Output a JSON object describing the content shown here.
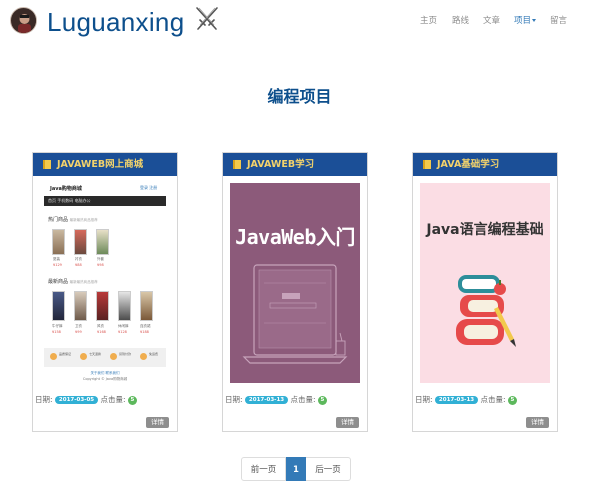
{
  "header": {
    "brand": "Luguanxing",
    "nav": [
      {
        "label": "主页",
        "active": false
      },
      {
        "label": "路线",
        "active": false
      },
      {
        "label": "文章",
        "active": false
      },
      {
        "label": "项目",
        "active": true,
        "dropdown": true
      },
      {
        "label": "留言",
        "active": false
      }
    ]
  },
  "page_title": "编程项目",
  "cards": [
    {
      "title": "JAVAWEB网上商城",
      "date_label": "日期:",
      "date": "2017-03-05",
      "clicks_label": "点击量:",
      "clicks": "5",
      "detail_label": "详情",
      "shop": {
        "logo": "Java购物商城",
        "links": "登录 注册",
        "nav_text": "首页  手机数码  电脑办公",
        "section1": "热门商品",
        "section1_sub": "最新最热商品推荐",
        "section2": "最新商品",
        "section2_sub": "最新最热商品推荐",
        "row1_labels": [
          "夏装",
          "衬衣",
          "外套"
        ],
        "row1_prices": [
          "¥129",
          "¥88",
          "¥98"
        ],
        "row2_labels": [
          "牛仔裤",
          "卫衣",
          "风衣",
          "休闲裤",
          "连衣裙"
        ],
        "row2_prices": [
          "¥158",
          "¥99",
          "¥168",
          "¥128",
          "¥188"
        ],
        "features": [
          "品质保证",
          "七天退换",
          "货到付款",
          "免运费"
        ],
        "footer1": "关于我们  联系我们",
        "footer2": "Copyright © Java购物商城"
      }
    },
    {
      "title": "JAVAWEB学习",
      "date_label": "日期:",
      "date": "2017-03-13",
      "clicks_label": "点击量:",
      "clicks": "5",
      "detail_label": "详情",
      "cover_title": "JavaWeb入门"
    },
    {
      "title": "JAVA基础学习",
      "date_label": "日期:",
      "date": "2017-03-13",
      "clicks_label": "点击量:",
      "clicks": "5",
      "detail_label": "详情",
      "cover_title": "Java语言编程基础"
    }
  ],
  "pagination": {
    "prev": "前一页",
    "current": "1",
    "next": "后一页"
  },
  "colors": {
    "brand": "#0d4f8c",
    "card_header": "#1b4f97",
    "card_title": "#f3d36b",
    "active_page": "#337ab7",
    "cover2_bg": "#8c5a7a",
    "cover3_bg": "#fbdde4"
  }
}
